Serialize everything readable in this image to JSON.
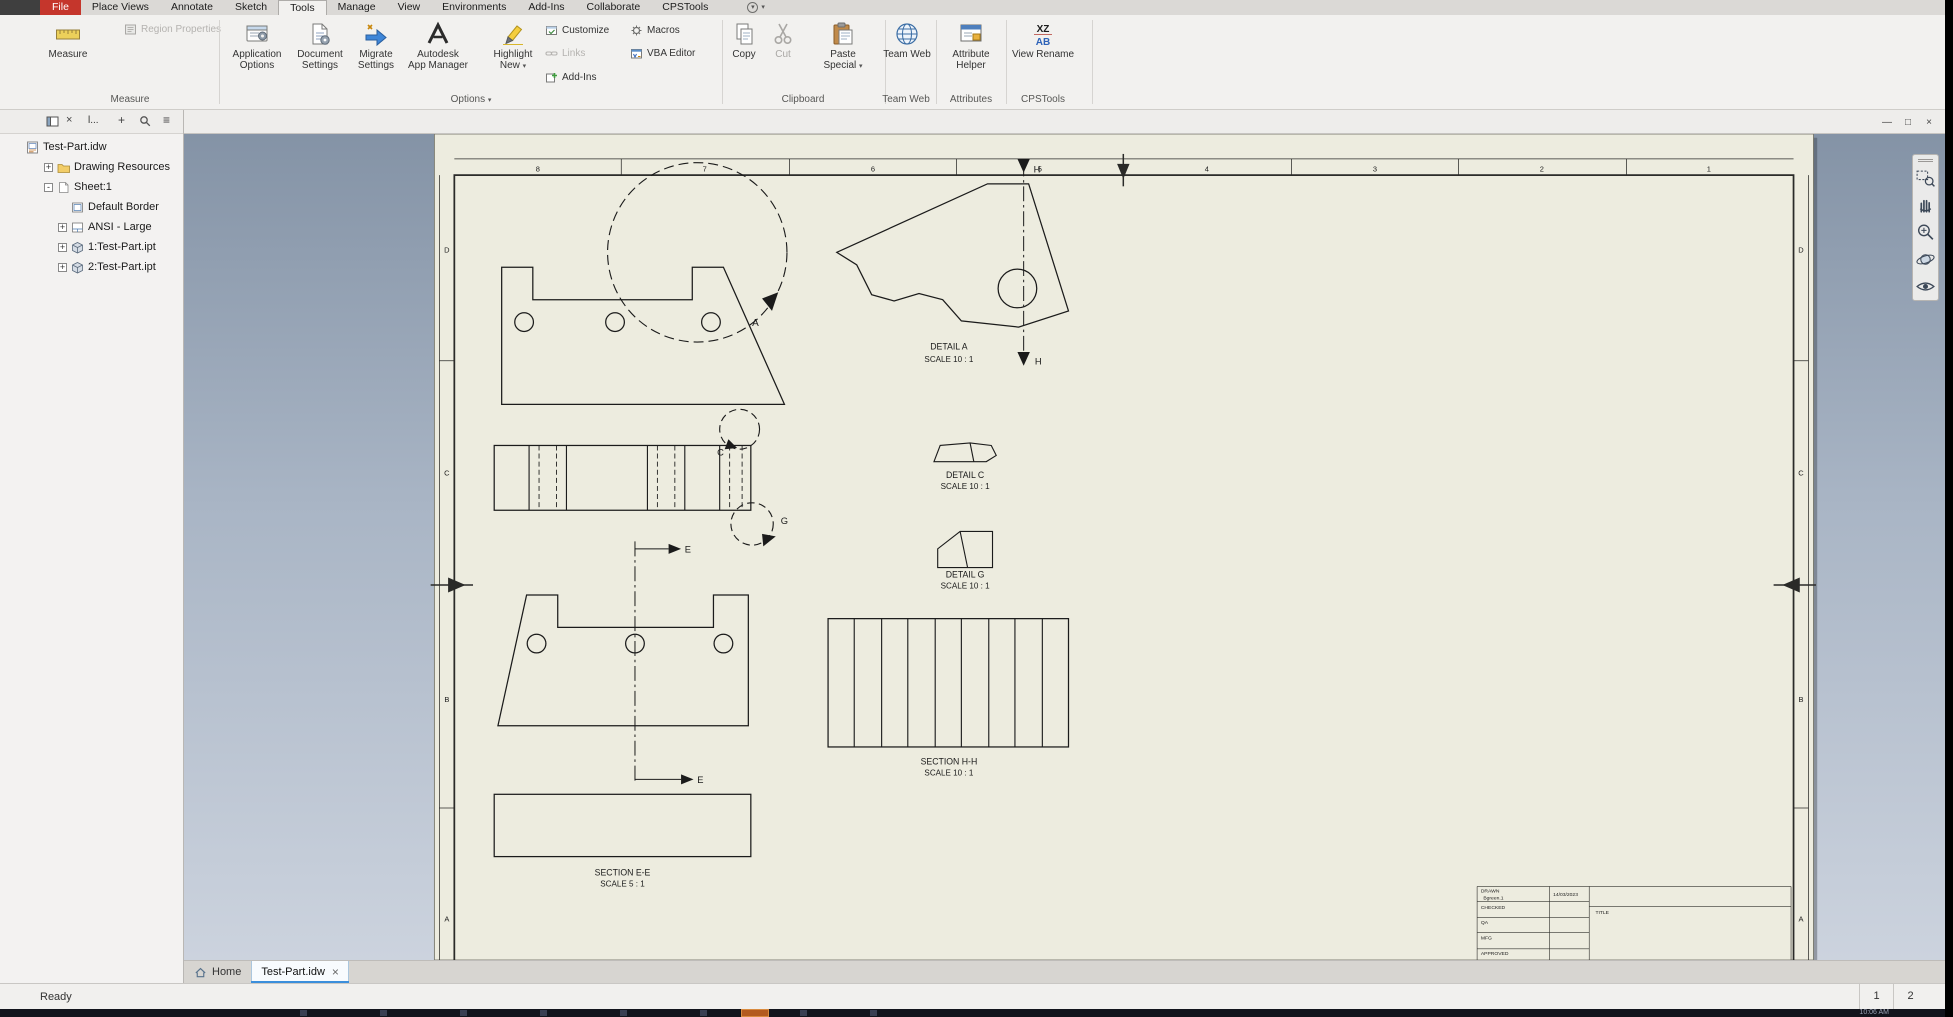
{
  "colors": {
    "file_tab_red": "#c5362c",
    "active_tab_blue": "#3b8edb",
    "sheet_cream": "#edecdf",
    "canvas_top": "#8493a6",
    "canvas_bottom": "#ccd3de"
  },
  "menu": {
    "items": [
      "File",
      "Place Views",
      "Annotate",
      "Sketch",
      "Tools",
      "Manage",
      "View",
      "Environments",
      "Add-Ins",
      "Collaborate",
      "CPSTools"
    ]
  },
  "ribbon": {
    "measure": {
      "group_label": "Measure",
      "measure": "Measure",
      "region_properties": "Region Properties"
    },
    "options": {
      "group_label": "Options",
      "application_options": [
        "Application",
        "Options"
      ],
      "document_settings": [
        "Document",
        "Settings"
      ],
      "migrate_settings": [
        "Migrate",
        "Settings"
      ],
      "app_manager": [
        "Autodesk",
        "App Manager"
      ],
      "highlight_new": [
        "Highlight",
        "New"
      ],
      "customize": "Customize",
      "links": "Links",
      "add_ins": "Add-Ins",
      "macros": "Macros",
      "vba_editor": "VBA Editor"
    },
    "clipboard": {
      "group_label": "Clipboard",
      "copy": "Copy",
      "cut": "Cut",
      "paste_special": [
        "Paste",
        "Special"
      ]
    },
    "team_web": {
      "group_label": "Team Web",
      "team_web": "Team Web"
    },
    "attributes": {
      "group_label": "Attributes",
      "attribute_helper": [
        "Attribute",
        "Helper"
      ]
    },
    "cpstools": {
      "group_label": "CPSTools",
      "view_rename": "View Rename",
      "icon_text": [
        "XZ",
        "AB"
      ]
    }
  },
  "browser": {
    "pane_filter": "l...",
    "tree": [
      {
        "expander": "",
        "label": "Test-Part.idw"
      },
      {
        "expander": "+",
        "label": "Drawing Resources"
      },
      {
        "expander": "-",
        "label": "Sheet:1"
      },
      {
        "expander": "",
        "label": "Default Border"
      },
      {
        "expander": "+",
        "label": "ANSI - Large"
      },
      {
        "expander": "+",
        "label": "1:Test-Part.ipt"
      },
      {
        "expander": "+",
        "label": "2:Test-Part.ipt"
      }
    ]
  },
  "drawing": {
    "zones": {
      "top": [
        "8",
        "7",
        "6",
        "5",
        "4",
        "3",
        "2",
        "1"
      ],
      "left": [
        "D",
        "C",
        "B",
        "A"
      ],
      "right": [
        "D",
        "C",
        "B",
        "A"
      ]
    },
    "labels": {
      "detail_a": [
        "DETAIL  A",
        "SCALE 10 : 1"
      ],
      "detail_c": [
        "DETAIL  C",
        "SCALE 10 : 1"
      ],
      "detail_g": [
        "DETAIL  G",
        "SCALE 10 : 1"
      ],
      "section_hh": [
        "SECTION H-H",
        "SCALE 10 : 1"
      ],
      "section_ee": [
        "SECTION E-E",
        "SCALE 5 : 1"
      ]
    },
    "markers": {
      "a": "A",
      "c": "C",
      "g": "G",
      "e": "E",
      "h": "H"
    },
    "titleblock": {
      "drawn": "DRAWN",
      "author": "Bgreen.1",
      "date": "14/03/2023",
      "checked": "CHECKED",
      "qa": "QA",
      "mfg": "MFG",
      "approved": "APPROVED",
      "title": "TITLE"
    }
  },
  "doc_window": {
    "minimize": "—",
    "restore": "□",
    "close": "×"
  },
  "tabs": {
    "home": "Home",
    "document": "Test-Part.idw",
    "close": "×"
  },
  "statusbar": {
    "message": "Ready",
    "field1": "1",
    "field2": "2"
  },
  "taskbar": {
    "time": "10:06 AM"
  }
}
